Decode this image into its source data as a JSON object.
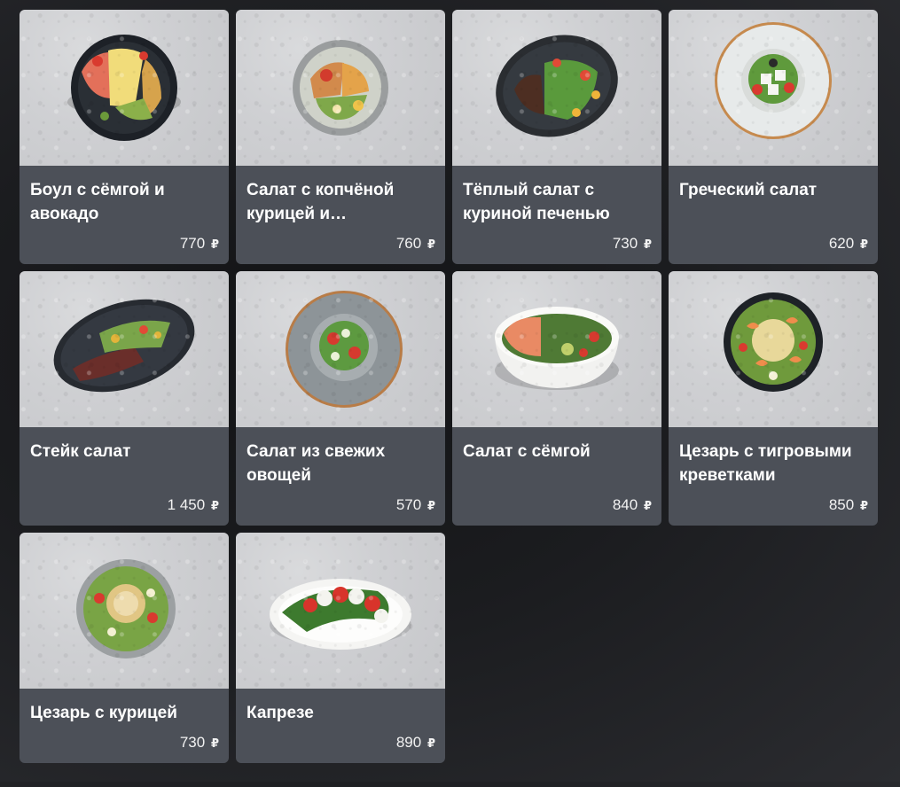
{
  "currency_symbol": "₽",
  "items": [
    {
      "name": "Боул с сёмгой и авокадо",
      "price": "770",
      "image": "salmon-avocado-bowl-image"
    },
    {
      "name": "Салат с копчёной курицей и…",
      "price": "760",
      "image": "smoked-chicken-salad-image"
    },
    {
      "name": "Тёплый салат с куриной печенью",
      "price": "730",
      "image": "warm-chicken-liver-salad-image"
    },
    {
      "name": "Греческий салат",
      "price": "620",
      "image": "greek-salad-image"
    },
    {
      "name": "Стейк салат",
      "price": "1 450",
      "image": "steak-salad-image"
    },
    {
      "name": "Салат из свежих овощей",
      "price": "570",
      "image": "fresh-vegetable-salad-image"
    },
    {
      "name": "Салат с сёмгой",
      "price": "840",
      "image": "salmon-salad-image"
    },
    {
      "name": "Цезарь с тигровыми креветками",
      "price": "850",
      "image": "caesar-tiger-prawns-image"
    },
    {
      "name": "Цезарь с курицей",
      "price": "730",
      "image": "caesar-chicken-image"
    },
    {
      "name": "Капрезе",
      "price": "890",
      "image": "caprese-image"
    }
  ]
}
